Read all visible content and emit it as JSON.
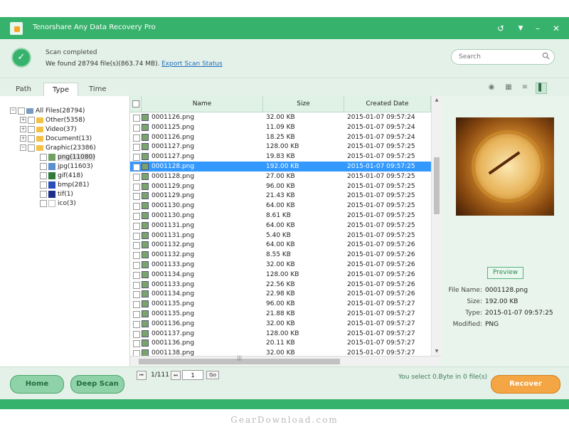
{
  "titlebar": {
    "title": "Tenorshare Any Data Recovery Pro"
  },
  "scan": {
    "status": "Scan completed",
    "found": "We found 28794 file(s)(863.74 MB).",
    "export_link": "Export Scan Status",
    "search_placeholder": "Search"
  },
  "tabs": [
    {
      "label": "Path"
    },
    {
      "label": "Type"
    },
    {
      "label": "Time"
    }
  ],
  "tree": {
    "root": "All Files(28794)",
    "items": [
      {
        "label": "Other(5358)"
      },
      {
        "label": "Video(37)"
      },
      {
        "label": "Document(13)"
      },
      {
        "label": "Graphic(23386)"
      }
    ],
    "graphic_children": [
      {
        "label": "png(11080)",
        "icon": "png-icon",
        "color": "#6f9f63"
      },
      {
        "label": "jpg(11603)",
        "icon": "jpg-icon",
        "color": "#5a8fd0"
      },
      {
        "label": "gif(418)",
        "icon": "gif-icon",
        "color": "#2e7a38"
      },
      {
        "label": "bmp(281)",
        "icon": "bmp-icon",
        "color": "#2a4fb8"
      },
      {
        "label": "tif(1)",
        "icon": "tif-icon",
        "color": "#1e2f8a"
      },
      {
        "label": "ico(3)",
        "icon": "ico-icon",
        "color": "#ffffff"
      }
    ]
  },
  "filelist": {
    "headers": {
      "name": "Name",
      "size": "Size",
      "created": "Created Date"
    },
    "rows": [
      {
        "name": "0001126.png",
        "size": "32.00 KB",
        "date": "2015-01-07 09:57:24"
      },
      {
        "name": "0001125.png",
        "size": "11.09 KB",
        "date": "2015-01-07 09:57:24"
      },
      {
        "name": "0001126.png",
        "size": "18.25 KB",
        "date": "2015-01-07 09:57:24"
      },
      {
        "name": "0001127.png",
        "size": "128.00 KB",
        "date": "2015-01-07 09:57:25"
      },
      {
        "name": "0001127.png",
        "size": "19.83 KB",
        "date": "2015-01-07 09:57:25"
      },
      {
        "name": "0001128.png",
        "size": "192.00 KB",
        "date": "2015-01-07 09:57:25"
      },
      {
        "name": "0001128.png",
        "size": "27.00 KB",
        "date": "2015-01-07 09:57:25"
      },
      {
        "name": "0001129.png",
        "size": "96.00 KB",
        "date": "2015-01-07 09:57:25"
      },
      {
        "name": "0001129.png",
        "size": "21.43 KB",
        "date": "2015-01-07 09:57:25"
      },
      {
        "name": "0001130.png",
        "size": "64.00 KB",
        "date": "2015-01-07 09:57:25"
      },
      {
        "name": "0001130.png",
        "size": "8.61 KB",
        "date": "2015-01-07 09:57:25"
      },
      {
        "name": "0001131.png",
        "size": "64.00 KB",
        "date": "2015-01-07 09:57:25"
      },
      {
        "name": "0001131.png",
        "size": "5.40 KB",
        "date": "2015-01-07 09:57:25"
      },
      {
        "name": "0001132.png",
        "size": "64.00 KB",
        "date": "2015-01-07 09:57:26"
      },
      {
        "name": "0001132.png",
        "size": "8.55 KB",
        "date": "2015-01-07 09:57:26"
      },
      {
        "name": "0001133.png",
        "size": "32.00 KB",
        "date": "2015-01-07 09:57:26"
      },
      {
        "name": "0001134.png",
        "size": "128.00 KB",
        "date": "2015-01-07 09:57:26"
      },
      {
        "name": "0001133.png",
        "size": "22.56 KB",
        "date": "2015-01-07 09:57:26"
      },
      {
        "name": "0001134.png",
        "size": "22.98 KB",
        "date": "2015-01-07 09:57:26"
      },
      {
        "name": "0001135.png",
        "size": "96.00 KB",
        "date": "2015-01-07 09:57:27"
      },
      {
        "name": "0001135.png",
        "size": "21.88 KB",
        "date": "2015-01-07 09:57:27"
      },
      {
        "name": "0001136.png",
        "size": "32.00 KB",
        "date": "2015-01-07 09:57:27"
      },
      {
        "name": "0001137.png",
        "size": "128.00 KB",
        "date": "2015-01-07 09:57:27"
      },
      {
        "name": "0001136.png",
        "size": "20.11 KB",
        "date": "2015-01-07 09:57:27"
      },
      {
        "name": "0001138.png",
        "size": "32.00 KB",
        "date": "2015-01-07 09:57:27"
      }
    ],
    "selected_index": 5
  },
  "preview": {
    "button": "Preview",
    "fields": [
      {
        "key": "File Name:",
        "value": "0001128.png"
      },
      {
        "key": "Size:",
        "value": "192.00 KB"
      },
      {
        "key": "Type:",
        "value": "2015-01-07 09:57:25"
      },
      {
        "key": "Modified:",
        "value": "PNG"
      }
    ]
  },
  "bottom": {
    "home": "Home",
    "deep_scan": "Deep Scan",
    "page_text": "1/111",
    "page_value": "1",
    "go": "Go",
    "selection_info": "You select 0.Byte in 0 file(s)",
    "recover": "Recover"
  },
  "watermark": "GearDownload.com",
  "colors": {
    "accent": "#37b26c",
    "recover": "#f4a544",
    "selection": "#3399ff"
  }
}
